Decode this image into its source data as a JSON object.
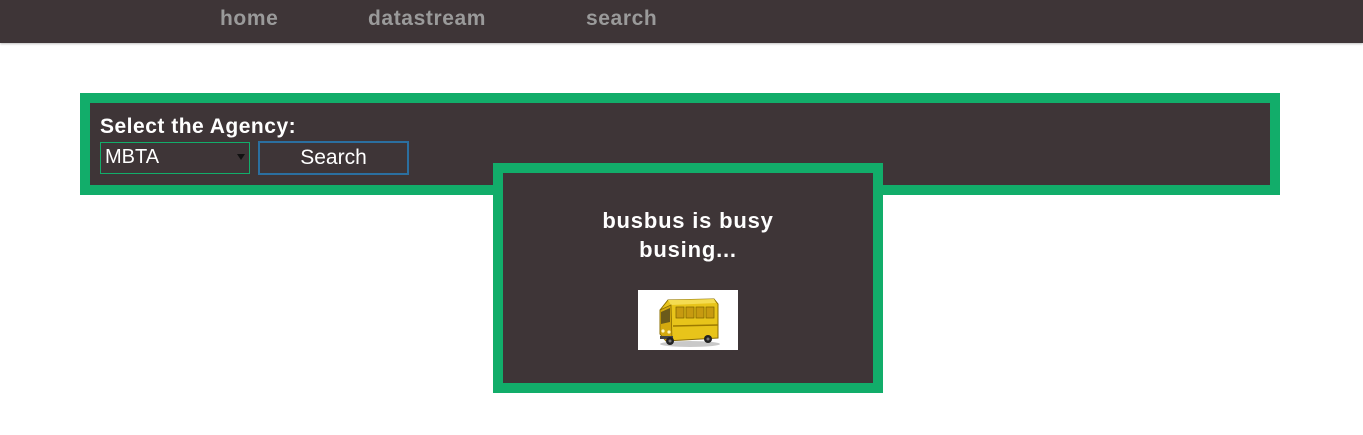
{
  "nav": {
    "items": [
      {
        "label": "home"
      },
      {
        "label": "datastream"
      },
      {
        "label": "search"
      }
    ]
  },
  "agency_form": {
    "label": "Select the Agency:",
    "selected_agency": "MBTA",
    "search_button_label": "Search"
  },
  "loading": {
    "line1": "busbus is busy",
    "line2": "busing...",
    "image_icon": "yellow-bus-icon"
  },
  "colors": {
    "panel_bg": "#3e3537",
    "accent_green": "#12ad6a",
    "button_border": "#2b6fa0",
    "bus_yellow": "#e8c41a"
  }
}
